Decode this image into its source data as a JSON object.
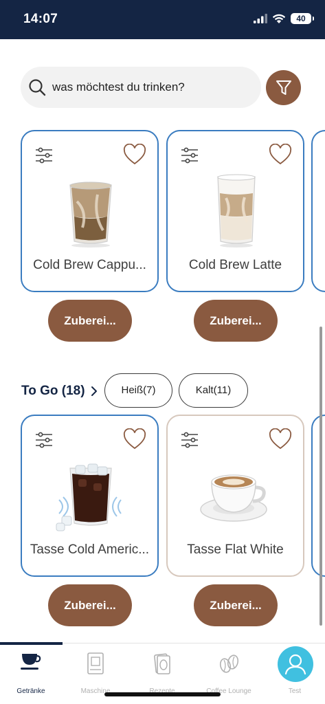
{
  "status_bar": {
    "time": "14:07",
    "battery": "40"
  },
  "search": {
    "placeholder": "was möchtest du trinken?"
  },
  "favorites": {
    "cards": [
      {
        "title": "Cold Brew Cappu...",
        "button": "Zuberei..."
      },
      {
        "title": "Cold Brew Latte",
        "button": "Zuberei..."
      }
    ]
  },
  "to_go": {
    "title": "To Go (18)",
    "chips": [
      "Heiß(7)",
      "Kalt(11)"
    ],
    "cards": [
      {
        "title": "Tasse Cold Americ...",
        "button": "Zuberei..."
      },
      {
        "title": "Tasse Flat White",
        "button": "Zuberei..."
      }
    ]
  },
  "tab_bar": {
    "tabs": [
      {
        "label": "Getränke",
        "icon": "cup-icon"
      },
      {
        "label": "Maschine",
        "icon": "machine-icon"
      },
      {
        "label": "Rezepte",
        "icon": "recipes-icon"
      },
      {
        "label": "Coffee Lounge",
        "icon": "coffee-beans-icon"
      },
      {
        "label": "Test",
        "icon": "avatar-icon"
      }
    ],
    "active": "Getränke"
  },
  "colors": {
    "navy": "#142544",
    "brown": "#8a5a40",
    "blue_border": "#3a7cc0",
    "beige_border": "#d7c8bd",
    "avatar": "#40c0e0"
  }
}
